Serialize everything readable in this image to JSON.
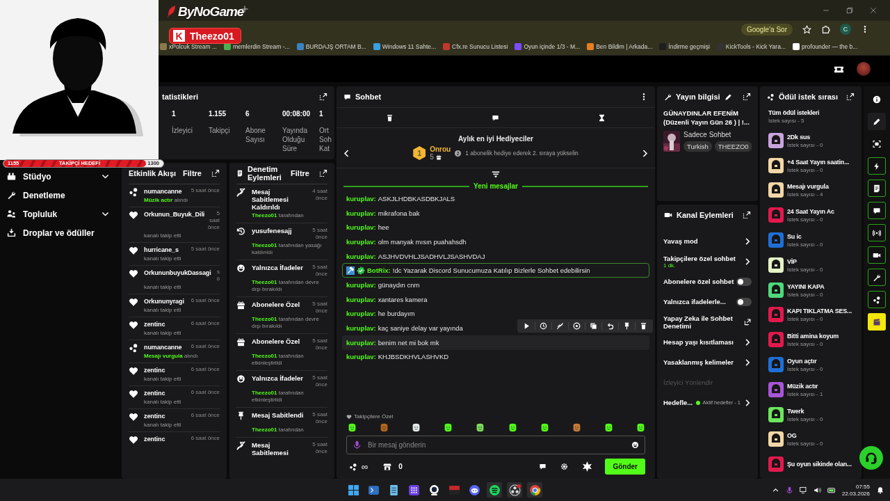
{
  "browser": {
    "bookmarks": [
      "xPolcuk Stream ...",
      "memlerdin Stream -...",
      "BURDAJŞ ORTAM B...",
      "Windows 11 Sahte...",
      "Cfx.re Sunucu Listesi",
      "Oyun içinde 1/3 - M...",
      "Ben Bildim | Arkada...",
      "İndirme geçmişi",
      "KickTools - Kick Yara...",
      "profounder — the b..."
    ],
    "ask_button": "Google'a Sor",
    "profile": "C"
  },
  "overlay": {
    "logo": "ByNoGame",
    "badge_letter": "K",
    "channel_badge": "Theezo01",
    "goal": {
      "start": "1155",
      "label": "TAKİPÇİ HEDEFİ",
      "end": "1300",
      "level": 0.89
    }
  },
  "sidebar": {
    "items": [
      {
        "kind": "studio",
        "label": "Stüdyo",
        "expandable": true
      },
      {
        "kind": "wrench",
        "label": "Denetleme",
        "expandable": false
      },
      {
        "kind": "community",
        "label": "Topluluk",
        "expandable": true
      },
      {
        "kind": "drops",
        "label": "Droplar ve ödüller",
        "expandable": false
      }
    ]
  },
  "stats": {
    "title": "tatistikleri",
    "items": [
      {
        "value": "1",
        "label": "İzleyici"
      },
      {
        "value": "1.155",
        "label": "Takipçi"
      },
      {
        "value": "6",
        "label": "Abone Sayısı"
      },
      {
        "value": "00:08:00",
        "label": "Yayında Olduğu Süre"
      },
      {
        "value": "1",
        "label": "Ort Soh Kat"
      }
    ]
  },
  "activity": {
    "title": "Etkinlik Akışı",
    "filter": "Filtre",
    "items": [
      {
        "kind": "reward",
        "user": "numancanne",
        "time": "5 saat önce",
        "reward": "Müzik actır",
        "detail": "alındı"
      },
      {
        "kind": "follow",
        "user": "Orkunun_Buyuk_Dili",
        "time": "5 saat önce",
        "detail": "kanalı takip etti"
      },
      {
        "kind": "follow",
        "user": "hurricane_s",
        "time": "5 saat önce",
        "detail": "kanalı takip etti"
      },
      {
        "kind": "follow",
        "user": "OrkununbuyukDassagi",
        "time": "s ö",
        "detail": "kanalı takip etti"
      },
      {
        "kind": "follow",
        "user": "Orkununyragi",
        "time": "6 saat önce",
        "detail": "kanalı takip etti"
      },
      {
        "kind": "follow",
        "user": "zentinc",
        "time": "6 saat önce",
        "detail": "kanalı takip etti"
      },
      {
        "kind": "reward",
        "user": "numancanne",
        "time": "6 saat önce",
        "reward": "Mesajı vurgula",
        "detail": "alındı"
      },
      {
        "kind": "follow",
        "user": "zentinc",
        "time": "6 saat önce",
        "detail": "kanalı takip etti"
      },
      {
        "kind": "follow",
        "user": "zentinc",
        "time": "6 saat önce",
        "detail": "kanalı takip etti"
      },
      {
        "kind": "follow",
        "user": "zentinc",
        "time": "6 saat önce",
        "detail": "kanalı takip etti"
      },
      {
        "kind": "follow",
        "user": "zentinc",
        "time": "6 saat önce"
      }
    ]
  },
  "moderation": {
    "title": "Denetim Eylemleri",
    "filter": "Filtre",
    "items": [
      {
        "kind": "unpin",
        "title": "Mesaj Sabitlemesi Kaldırıldı",
        "time": "4 saat önce",
        "by": "Theezo01",
        "action": "tarafından"
      },
      {
        "kind": "unban",
        "title": "yusufenesajj",
        "time": "5 saat önce",
        "by": "Theezo01",
        "action": "tarafından yasağı kaldırıldı"
      },
      {
        "kind": "emote",
        "title": "Yalnızca İfadeler",
        "time": "5 saat önce",
        "by": "Theezo01",
        "action": "tarafından devre dışı bırakıldı"
      },
      {
        "kind": "gift",
        "title": "Abonelere Özel",
        "time": "5 saat önce",
        "by": "Theezo01",
        "action": "tarafından devre dışı bırakıldı"
      },
      {
        "kind": "gift",
        "title": "Abonelere Özel",
        "time": "5 saat önce",
        "by": "Theezo01",
        "action": "tarafından etkinleştirildi"
      },
      {
        "kind": "emote",
        "title": "Yalnızca İfadeler",
        "time": "5 saat önce",
        "by": "Theezo01",
        "action": "tarafından etkinleştirildi"
      },
      {
        "kind": "pin",
        "title": "Mesaj Sabitlendi",
        "time": "5 saat önce",
        "by": "Theezo01",
        "action": "tarafından"
      },
      {
        "kind": "unpin",
        "title": "Mesaj Sabitlemesi",
        "time": "5 saat önce"
      }
    ]
  },
  "chat": {
    "title": "Sohbet",
    "gifters": {
      "title": "Aylık en iyi Hediyeciler",
      "rank": "1",
      "name": "Onrou",
      "count": "5",
      "next_rank": "2",
      "hint": "1 abonelik hediye ederek 2. sıraya yükselin"
    },
    "divider": "Yeni mesajlar",
    "messages": [
      {
        "kind": "user",
        "user": "kuruplav:",
        "text": "ASKJLHDBKASDBKJALS",
        "hovered": false
      },
      {
        "kind": "user",
        "user": "kuruplav:",
        "text": "mikrafona bak",
        "hovered": false
      },
      {
        "kind": "user",
        "user": "kuruplav:",
        "text": "hee",
        "hovered": false
      },
      {
        "kind": "user",
        "user": "kuruplav:",
        "text": "olm manyak mısın puahahsdh",
        "hovered": false
      },
      {
        "kind": "user",
        "user": "kuruplav:",
        "text": "ASJHVDVHLJSADHVLJSASHVDAJ",
        "hovered": false
      },
      {
        "kind": "bot",
        "user": "BotRix:",
        "text": "!dc Yazarak Discord Sunucumuza Katılıp Bizlerle Sohbet edebilirsin",
        "hovered": false
      },
      {
        "kind": "user",
        "user": "kuruplav:",
        "text": "günaydın cnm",
        "hovered": false
      },
      {
        "kind": "user",
        "user": "kuruplav:",
        "text": "xantares kamera",
        "hovered": false
      },
      {
        "kind": "user",
        "user": "kuruplav:",
        "text": "he burdayım",
        "hovered": false
      },
      {
        "kind": "user",
        "user": "kuruplav:",
        "text": "kaç saniye delay var yayında",
        "hovered": false
      },
      {
        "kind": "user",
        "user": "kuruplav:",
        "text": "benim net mi bok mk",
        "hovered": true
      },
      {
        "kind": "user",
        "user": "kuruplav:",
        "text": "KHJBSDKHVLASHVKD",
        "hovered": false
      }
    ],
    "follower_only": "Takipçilere Özel",
    "placeholder": "Bir mesaj gönderin",
    "points": "∞",
    "store_count": "0",
    "send": "Gönder"
  },
  "stream_info": {
    "title": "Yayın bilgisi",
    "stream_title": "GÜNAYDINLAR EFENİM (Düzenli Yayın Gün 26 ) | !...",
    "category": "Sadece Sohbet",
    "tags": [
      "Turkish",
      "THEEZO0"
    ]
  },
  "channel_actions": {
    "title": "Kanal Eylemleri",
    "rows": [
      {
        "kind": "chevron",
        "label": "Yavaş mod"
      },
      {
        "kind": "chevron",
        "label": "Takipçilere özel sohbet",
        "sub": "1 dk."
      },
      {
        "kind": "toggle",
        "label": "Abonelere özel sohbet",
        "on": false
      },
      {
        "kind": "toggle",
        "label": "Yalnızca ifadelerle...",
        "on": false
      },
      {
        "kind": "external",
        "label": "Yapay Zeka ile Sohbet Denetimi"
      },
      {
        "kind": "chevron",
        "label": "Hesap yaşı kısıtlaması"
      },
      {
        "kind": "chevron",
        "label": "Yasaklanmış kelimeler"
      },
      {
        "kind": "muted",
        "label": "İzleyici Yönlendir"
      },
      {
        "kind": "goals",
        "label": "Hedefle...",
        "sub": "Aktif hedefler - 1"
      }
    ]
  },
  "rewards": {
    "title": "Ödül istek sırası",
    "all": {
      "name": "Tüm ödül istekleri",
      "count": "İstek sayısı - 5"
    },
    "items": [
      {
        "name": "2Dk sus",
        "count": "İstek sayısı - 0",
        "color": "#c9a3dd"
      },
      {
        "name": "+4 Saat Yayın saatin...",
        "count": "İstek sayısı - 0",
        "color": "#f3d7a6"
      },
      {
        "name": "Mesajı vurgula",
        "count": "İstek sayısı - 4",
        "color": "#f3d7a6"
      },
      {
        "name": "24 Saat Yayın Ac",
        "count": "İstek sayısı - 0",
        "color": "#e2194d"
      },
      {
        "name": "Su ic",
        "count": "İstek sayısı - 0",
        "color": "#1f6fd6"
      },
      {
        "name": "VİP",
        "count": "İstek sayısı - 0",
        "color": "#e4f3c6"
      },
      {
        "name": "YAYINI KAPA",
        "count": "İstek sayısı - 0",
        "color": "#4fd97c"
      },
      {
        "name": "KAPI TIKLATMA SES...",
        "count": "İstek sayısı - 0",
        "color": "#e2194d"
      },
      {
        "name": "Bitti amina koyum",
        "count": "İstek sayısı - 0",
        "color": "#e2194d"
      },
      {
        "name": "Oyun açtır",
        "count": "İstek sayısı - 0",
        "color": "#1f6fd6"
      },
      {
        "name": "Müzik actır",
        "count": "İstek sayısı - 1",
        "color": "#a855d8"
      },
      {
        "name": "Twerk",
        "count": "İstek sayısı - 0",
        "color": "#6be65b"
      },
      {
        "name": "OG",
        "count": "İstek sayısı - 0",
        "color": "#f3d7a6"
      },
      {
        "name": "Şu oyun sikinde olan...",
        "color": "#e2194d"
      }
    ]
  },
  "rail": [
    {
      "kind": "info",
      "highlighted": false
    },
    {
      "kind": "pencil",
      "highlighted": false
    },
    {
      "kind": "scan",
      "highlighted": false
    },
    {
      "kind": "bolt",
      "highlighted": true
    },
    {
      "kind": "note",
      "highlighted": true
    },
    {
      "kind": "chat",
      "highlighted": true
    },
    {
      "kind": "broadcast",
      "highlighted": true
    },
    {
      "kind": "camera",
      "highlighted": true
    },
    {
      "kind": "wrench",
      "highlighted": true
    },
    {
      "kind": "dots",
      "highlighted": true
    },
    {
      "kind": "clapper",
      "highlighted": false
    }
  ],
  "taskbar": {
    "apps": [
      {
        "kind": "start",
        "running": false
      },
      {
        "kind": "terminal",
        "running": false
      },
      {
        "kind": "notepad",
        "running": false
      },
      {
        "kind": "grid",
        "running": false
      },
      {
        "kind": "webcam",
        "running": false
      },
      {
        "kind": "mixer",
        "running": false
      },
      {
        "kind": "discord",
        "running": false
      },
      {
        "kind": "spotify",
        "running": true
      },
      {
        "kind": "obs",
        "running": true
      },
      {
        "kind": "chrome",
        "running": true
      }
    ],
    "time": "07:55",
    "date": "22.03.2026"
  }
}
